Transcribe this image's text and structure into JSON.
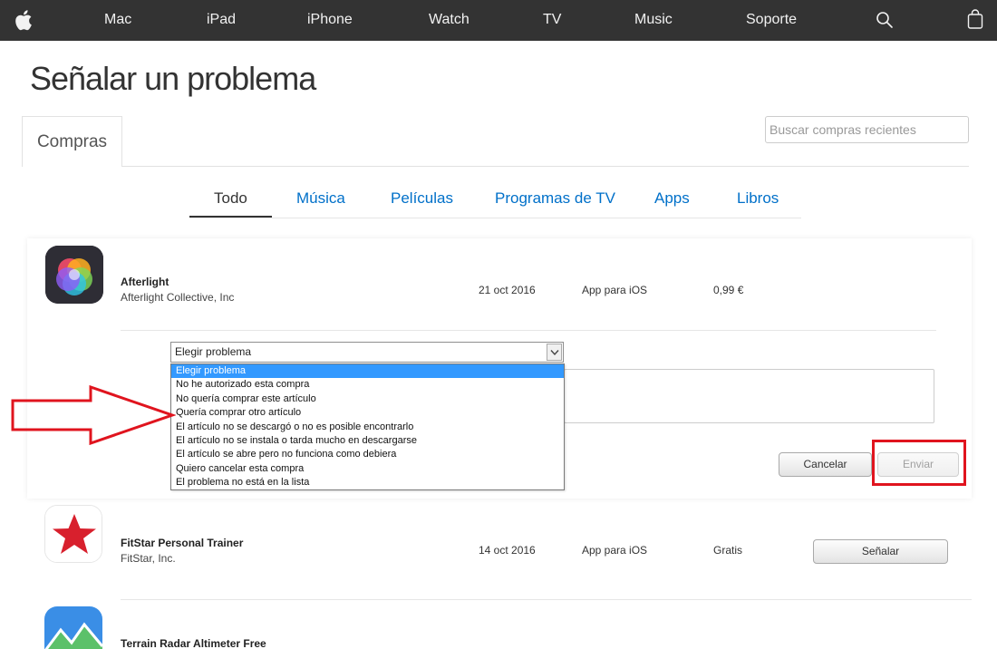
{
  "nav": {
    "items": [
      "Mac",
      "iPad",
      "iPhone",
      "Watch",
      "TV",
      "Music",
      "Soporte"
    ]
  },
  "page": {
    "title": "Señalar un problema"
  },
  "tabs": {
    "compras": "Compras"
  },
  "search": {
    "placeholder": "Buscar compras recientes"
  },
  "filters": [
    "Todo",
    "Música",
    "Películas",
    "Programas de TV",
    "Apps",
    "Libros"
  ],
  "active_filter": "Todo",
  "colors": {
    "nav_bg": "#333333",
    "link": "#0070c9",
    "highlight": "#3399ff",
    "annotation_red": "#e0141e"
  },
  "purchases": [
    {
      "name": "Afterlight",
      "developer": "Afterlight Collective, Inc",
      "date": "21 oct 2016",
      "kind": "App para iOS",
      "price": "0,99 €",
      "icon": "afterlight-icon"
    },
    {
      "name": "FitStar Personal Trainer",
      "developer": "FitStar, Inc.",
      "date": "14 oct 2016",
      "kind": "App para iOS",
      "price": "Gratis",
      "action": "Señalar",
      "icon": "fitstar-icon"
    },
    {
      "name": "Terrain Radar Altimeter Free",
      "icon": "terrain-radar-icon"
    }
  ],
  "problem_form": {
    "select_value": "Elegir problema",
    "options": [
      "Elegir problema",
      "No he autorizado esta compra",
      "No quería comprar este artículo",
      "Quería comprar otro artículo",
      "El artículo no se descargó o no es posible encontrarlo",
      "El artículo no se instala o tarda mucho en descargarse",
      "El artículo se abre pero no funciona como debiera",
      "Quiero cancelar esta compra",
      "El problema no está en la lista"
    ],
    "cancel_label": "Cancelar",
    "send_label": "Enviar"
  }
}
